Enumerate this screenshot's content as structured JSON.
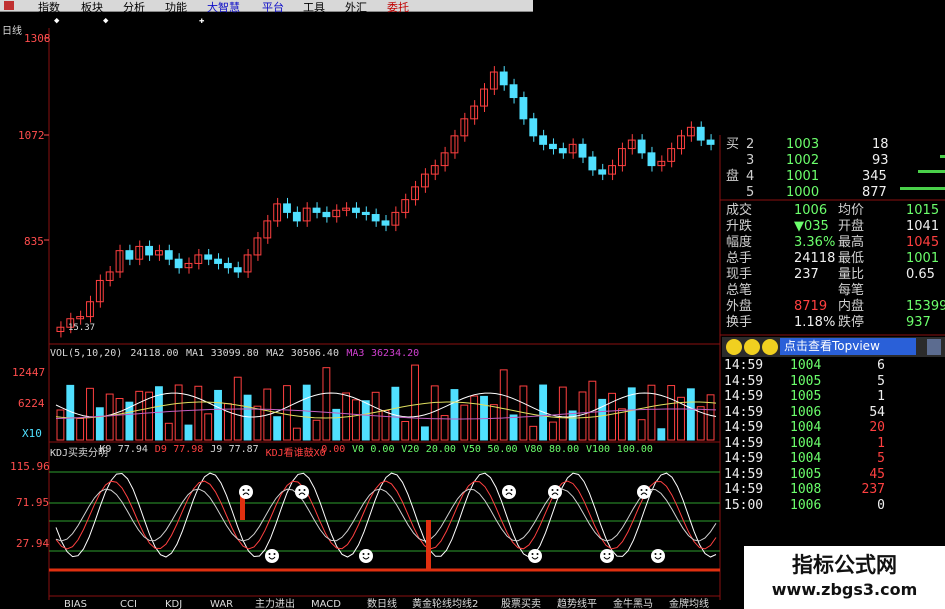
{
  "menu": {
    "items": [
      {
        "label": "指数",
        "style": "normal"
      },
      {
        "label": "板块",
        "style": "normal"
      },
      {
        "label": "分析",
        "style": "normal"
      },
      {
        "label": "功能",
        "style": "normal"
      },
      {
        "label": "大智慧",
        "style": "hl"
      },
      {
        "label": "平台",
        "style": "hl"
      },
      {
        "label": "工具",
        "style": "normal"
      },
      {
        "label": "外汇",
        "style": "normal"
      },
      {
        "label": "委托",
        "style": "red"
      }
    ]
  },
  "price_pane": {
    "period_label": "日线",
    "y_ticks": [
      "1308",
      "1072",
      "835"
    ],
    "low_label": "15.37",
    "ylim": [
      600,
      1310
    ]
  },
  "volume_pane": {
    "header": [
      {
        "text": "VOL(5,10,20)",
        "color": "#d8d8d8"
      },
      {
        "text": "24118.00",
        "color": "#d8d8d8"
      },
      {
        "text": "MA1",
        "color": "#d8d8d8"
      },
      {
        "text": "33099.80",
        "color": "#d8d8d8"
      },
      {
        "text": "MA2",
        "color": "#d8d8d8"
      },
      {
        "text": "30506.40",
        "color": "#d8d8d8"
      },
      {
        "text": "MA3",
        "color": "#d040d0"
      },
      {
        "text": "36234.20",
        "color": "#d040d0"
      }
    ],
    "y_ticks": [
      "12447",
      "6224"
    ],
    "unit_label": "X10"
  },
  "kdj_pane": {
    "header": [
      {
        "text": "KDJ买卖分明",
        "color": "#d8d8d8"
      },
      {
        "text": "K9",
        "color": "#d8d8d8"
      },
      {
        "text": "77.94",
        "color": "#d8d8d8"
      },
      {
        "text": "D9",
        "color": "#ff4040"
      },
      {
        "text": "77.98",
        "color": "#ff4040"
      },
      {
        "text": "J9",
        "color": "#d8d8d8"
      },
      {
        "text": "77.87",
        "color": "#d8d8d8"
      },
      {
        "text": "KDJ看谁鼓X0",
        "color": "#ff4040"
      },
      {
        "text": "0.00",
        "color": "#ff4040"
      },
      {
        "text": "V0",
        "color": "#6cff6c"
      },
      {
        "text": "0.00",
        "color": "#6cff6c"
      },
      {
        "text": "V20",
        "color": "#6cff6c"
      },
      {
        "text": "20.00",
        "color": "#6cff6c"
      },
      {
        "text": "V50",
        "color": "#6cff6c"
      },
      {
        "text": "50.00",
        "color": "#6cff6c"
      },
      {
        "text": "V80",
        "color": "#6cff6c"
      },
      {
        "text": "80.00",
        "color": "#6cff6c"
      },
      {
        "text": "V100",
        "color": "#6cff6c"
      },
      {
        "text": "100.00",
        "color": "#6cff6c"
      }
    ],
    "y_ticks": [
      "115.96",
      "71.95",
      "27.94"
    ]
  },
  "order_book": {
    "rows": [
      {
        "side": "买",
        "level": "2",
        "price": "1003",
        "volume": "18"
      },
      {
        "side": "",
        "level": "3",
        "price": "1002",
        "volume": "93"
      },
      {
        "side": "盘",
        "level": "4",
        "price": "1001",
        "volume": "345"
      },
      {
        "side": "",
        "level": "5",
        "price": "1000",
        "volume": "877"
      }
    ]
  },
  "quote": {
    "rows": [
      {
        "l1": "成交",
        "v1": "1006",
        "v1c": "val-green",
        "l2": "均价",
        "v2": "1015",
        "v2c": "val-green"
      },
      {
        "l1": "升跌",
        "v1": "▼035",
        "v1c": "val-green",
        "l2": "开盘",
        "v2": "1041",
        "v2c": "val-white"
      },
      {
        "l1": "幅度",
        "v1": "3.36%",
        "v1c": "val-green",
        "l2": "最高",
        "v2": "1045",
        "v2c": "val-red"
      },
      {
        "l1": "总手",
        "v1": "24118",
        "v1c": "val-white",
        "l2": "最低",
        "v2": "1001",
        "v2c": "val-green"
      },
      {
        "l1": "现手",
        "v1": "237",
        "v1c": "val-white",
        "l2": "量比",
        "v2": "0.65",
        "v2c": "val-white"
      },
      {
        "l1": "总笔",
        "v1": "",
        "v1c": "val-white",
        "l2": "每笔",
        "v2": "",
        "v2c": "val-white"
      },
      {
        "l1": "外盘",
        "v1": "8719",
        "v1c": "val-red",
        "l2": "内盘",
        "v2": "15399",
        "v2c": "val-green"
      },
      {
        "l1": "换手",
        "v1": "1.18%",
        "v1c": "val-white",
        "l2": "跌停",
        "v2": "937",
        "v2c": "val-green"
      }
    ]
  },
  "topview": {
    "label": "点击查看Topview"
  },
  "ticks": {
    "rows": [
      {
        "time": "14:59",
        "price": "1004",
        "volume": "6",
        "vc": "val-white"
      },
      {
        "time": "14:59",
        "price": "1005",
        "volume": "5",
        "vc": "val-white"
      },
      {
        "time": "14:59",
        "price": "1005",
        "volume": "1",
        "vc": "val-white"
      },
      {
        "time": "14:59",
        "price": "1006",
        "volume": "54",
        "vc": "val-white"
      },
      {
        "time": "14:59",
        "price": "1004",
        "volume": "20",
        "vc": "val-red"
      },
      {
        "time": "14:59",
        "price": "1004",
        "volume": "1",
        "vc": "val-red"
      },
      {
        "time": "14:59",
        "price": "1004",
        "volume": "5",
        "vc": "val-red"
      },
      {
        "time": "14:59",
        "price": "1005",
        "volume": "45",
        "vc": "val-red"
      },
      {
        "time": "14:59",
        "price": "1008",
        "volume": "237",
        "vc": "val-red"
      },
      {
        "time": "15:00",
        "price": "1006",
        "volume": "0",
        "vc": "val-white"
      }
    ]
  },
  "bottom_tabs": [
    "BIAS",
    "CCI",
    "KDJ",
    "WAR",
    "主力进出",
    "MACD",
    "数日线",
    "黄金轮线均线2",
    "股票买卖",
    "趋势线平",
    "金牛黑马",
    "金牌均线"
  ],
  "watermark": {
    "title": "指标公式网",
    "url": "www.zbgs3.com"
  },
  "colors": {
    "up": "#ff4040",
    "down": "#50e0ff",
    "grid": "#8a1010",
    "ma_white": "#ffffff",
    "ma_yellow": "#e0e060",
    "ma_purple": "#c060c0"
  }
}
